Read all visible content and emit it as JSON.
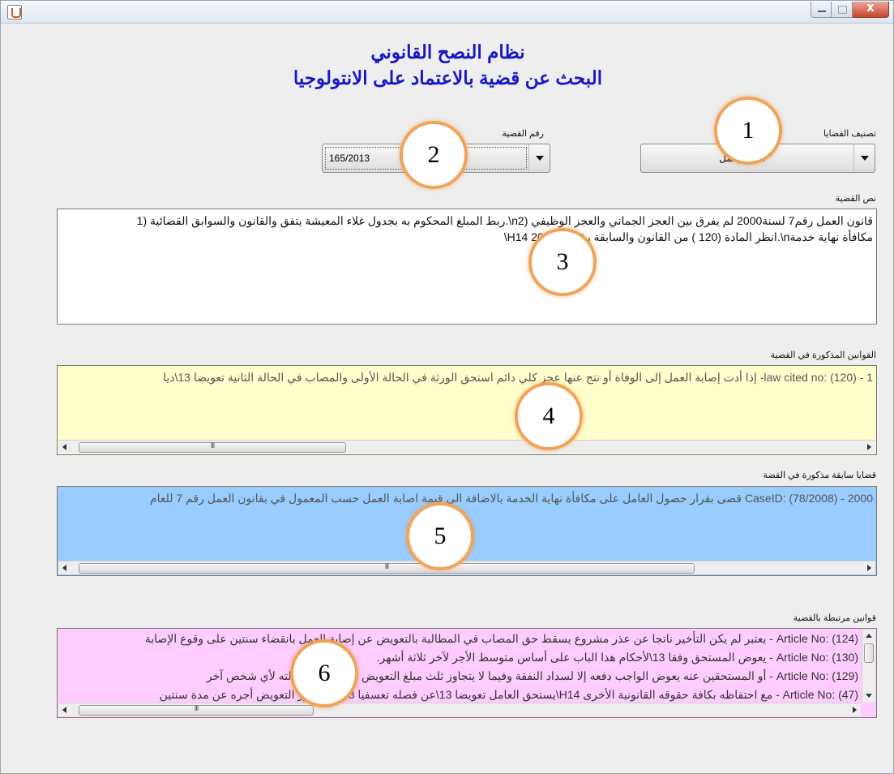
{
  "window": {
    "title_icon": "java-cup-icon",
    "controls": [
      "minimize",
      "maximize",
      "close"
    ]
  },
  "header": {
    "title": "نظام النصح القانوني",
    "subtitle": "البحث عن قضية بالاعتماد على الانتولوجيا"
  },
  "filters": {
    "category_label": "تصنيف القضايا",
    "category_value": "اصابة_عمل",
    "case_number_label": "رقم القضية",
    "case_number_value": "165/2013"
  },
  "case_text": {
    "label": "نص القضية",
    "lines": [
      "قانون العمل رقم7  لسنة2000 لم يفرق بين العجز الجماني والعجز الوظيفي (n2\\.ربط المبلغ المحكوم به بجدول غلاء المعيشة يتفق والقانون والسوابق القضائية (1",
      "مكافأة نهاية خدمةn\\.انظر المادة (120 ) من القانون والسابقة رقم2006/78 H14\\"
    ]
  },
  "laws_cited": {
    "label": "القوانين المذكورة في القضية",
    "text": "law cited no: (120) - 1- إذا أدت إصابة العمل إلى الوفاة أو نتج عنها عجز كلي دائم استحق الورثة في الحالة الأولى والمصاب في الحالة الثانية تعويضا 13\\ديا"
  },
  "previous_cases": {
    "label": "قضايا سابقة مذكورة في القضة",
    "text": "CaseID: (78/2008) - 2000 قضى بقرار حصول العامل على مكافأة نهاية الخدمة بالاضافة الى قيمة اصابة العمل حسب المعمول في بقانون العمل رقم 7 للعام"
  },
  "related_laws": {
    "label": "قوانين مرتبطة بالقضية",
    "lines": [
      "Article No: (124) - يعتبر لم يكن التأخير ناتجا عن عذر مشروع يسقط حق المصاب في المطالبة بالتعويض عن إصابة العمل بانقضاء سنتين على وقوع الإصابة",
      "Article No: (130) - يعوض المستحق وفقا 13\\لأحكام هذا الباب على أساس متوسط الأجر لآخر ثلاثة أشهر.",
      "Article No: (129) - أو المستحقين عنه   يعوض الواجب دفعه إلا لسداد النفقة وفيما لا يتجاوز ثلث مبلغ التعويض كما لا يجوز إحالته لأي شخص آخر",
      "Article No: (47) - مع احتفاظه بكافة حقوقه القانونية الأخرى H14\\يستحق العامل تعويضا 13\\عن فصله تعسفيا 13\\ألا يتجاوز التعويض أجره عن مدة سنتين"
    ]
  },
  "callouts": [
    "1",
    "2",
    "3",
    "4",
    "5",
    "6"
  ],
  "colors": {
    "title": "#1616c6",
    "laws_cited_bg": "#ffffcc",
    "previous_cases_bg": "#99ccff",
    "related_laws_bg": "#ffccff",
    "callout_border": "#f0a45a"
  }
}
